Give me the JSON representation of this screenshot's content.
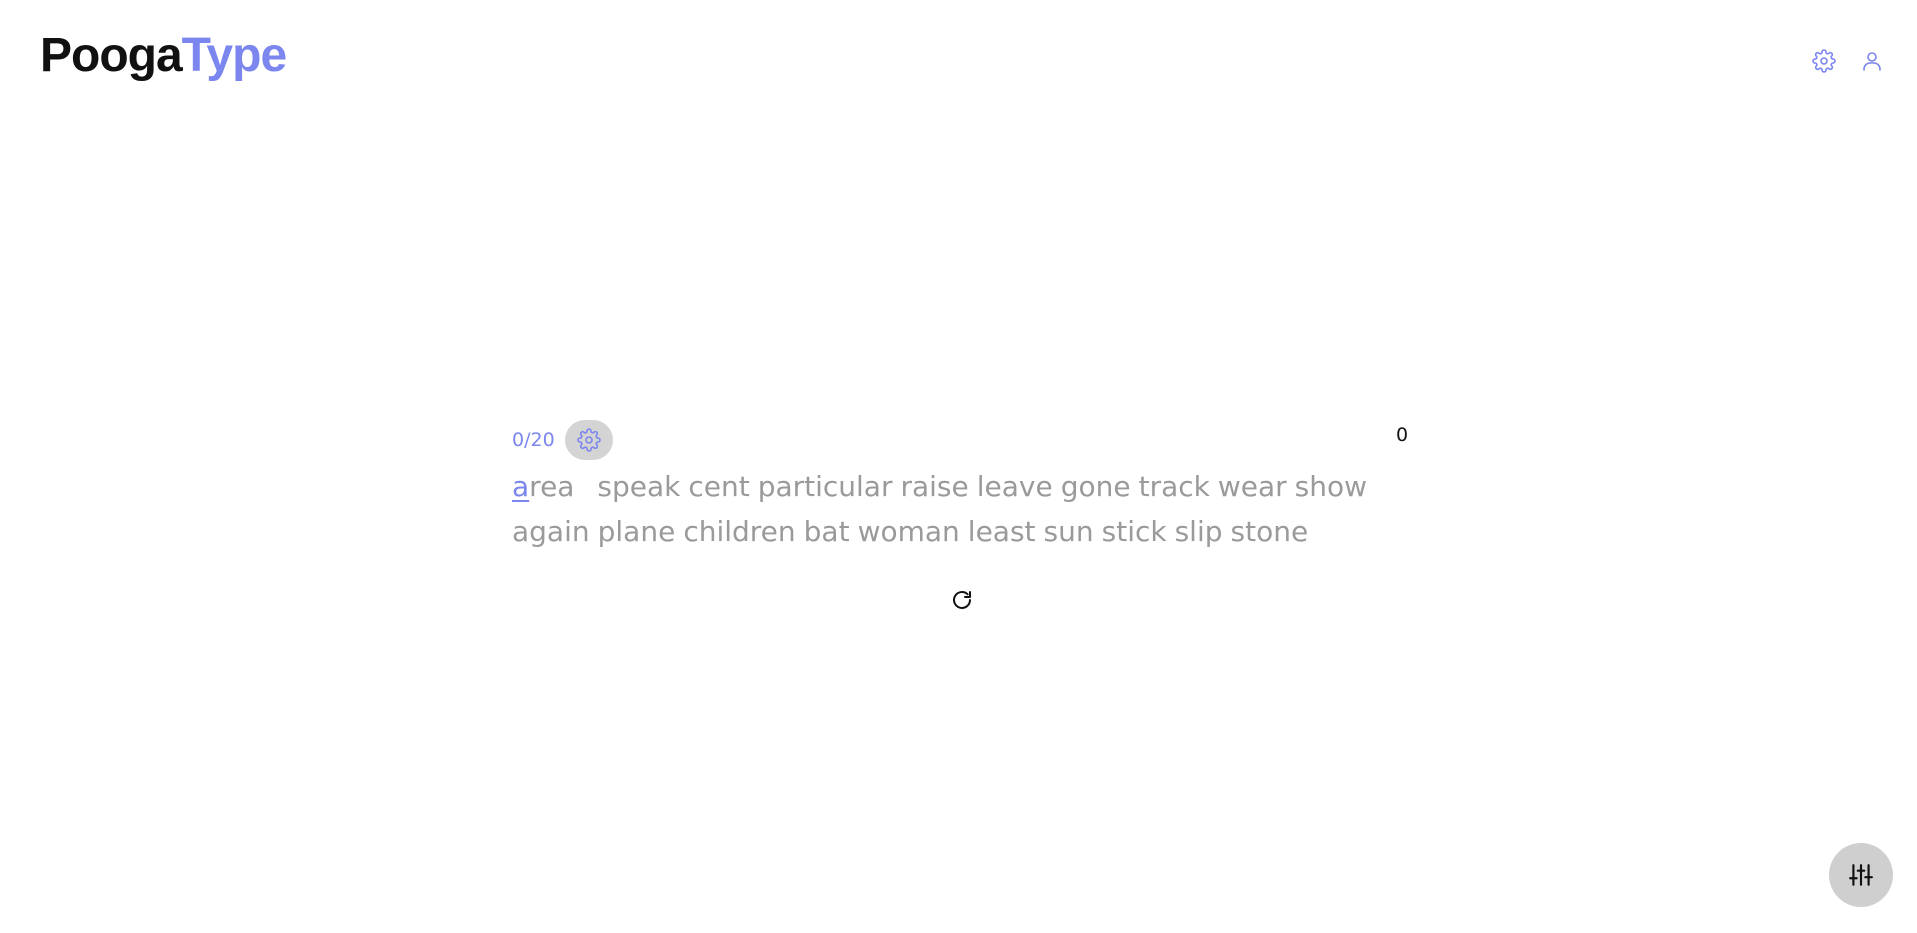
{
  "brand": {
    "part1": "Pooga",
    "part2": "Type",
    "accent_color": "#7b86ee"
  },
  "header": {
    "icons": [
      "gear-icon",
      "user-icon"
    ]
  },
  "test": {
    "counter": "0/20",
    "wpm": "0",
    "current_char": "a",
    "first_word_rest": "rea",
    "words": [
      "speak",
      "cent",
      "particular",
      "raise",
      "leave",
      "gone",
      "track",
      "wear",
      "show",
      "again",
      "plane",
      "children",
      "bat",
      "woman",
      "least",
      "sun",
      "stick",
      "slip",
      "stone"
    ],
    "settings_icon": "gear-icon",
    "restart_icon": "refresh-icon"
  },
  "fab": {
    "icon": "sliders-icon"
  }
}
